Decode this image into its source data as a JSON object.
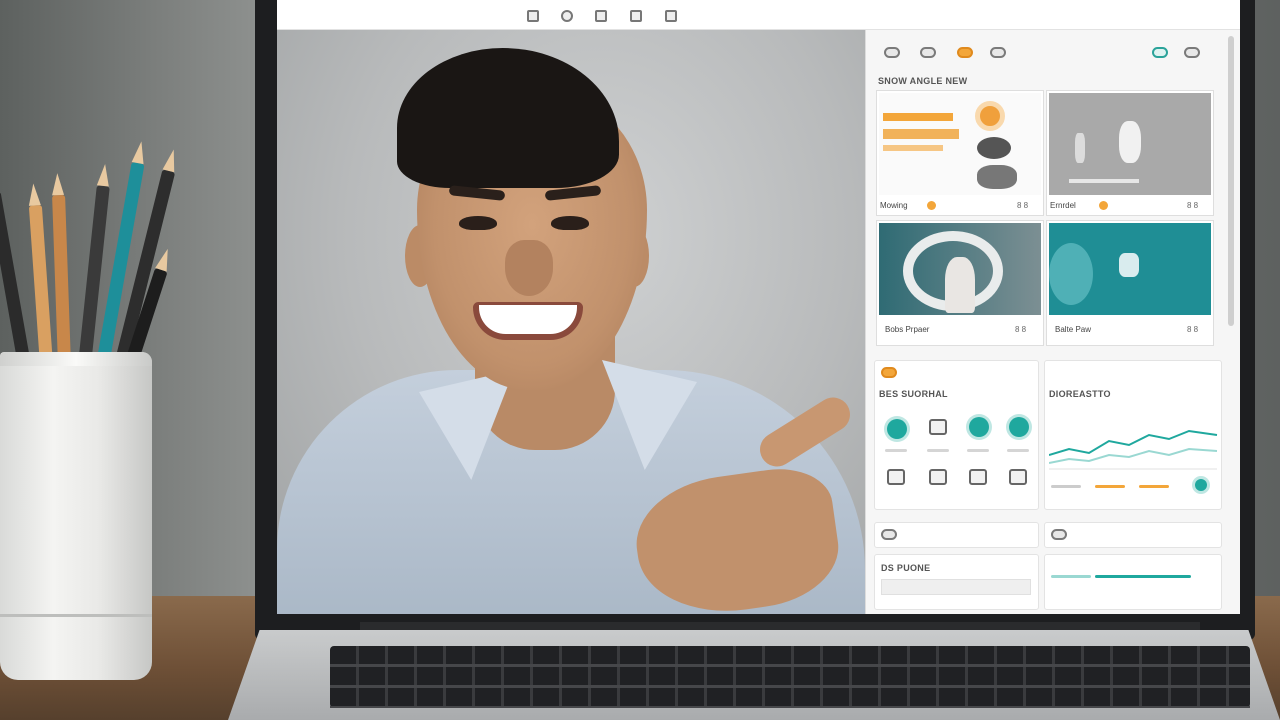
{
  "scene": {
    "description_free": true,
    "pencil_colors": [
      "#2b2b2b",
      "#d9a061",
      "#1e8f9a",
      "#3a3a3a",
      "#c8874a",
      "#2d2d2d",
      "#e0b67a",
      "#1d1d1d"
    ]
  },
  "screen_app": {
    "toolbar_icons": [
      "square-icon",
      "record-icon",
      "square-icon",
      "square-icon",
      "square-icon"
    ],
    "side_panel": {
      "section_heading": "SNOW ANGLE NEW",
      "cards": [
        {
          "caption": "Mowing",
          "meta": "8 8",
          "accent": "#f3a63a"
        },
        {
          "caption": "Ernrdel",
          "meta": "8 8",
          "accent": "#f3a63a"
        },
        {
          "caption": "Bobs Prpaer",
          "meta": "8 8",
          "accent": "#e08a1d"
        },
        {
          "caption": "Balte Paw",
          "meta": "8 8",
          "accent": "#e08a1d"
        }
      ],
      "tools_heading": "BES SUORHAL",
      "chart_heading": "DIOREASTTO",
      "note_heading": "DS PUONE",
      "accent_color": "#f3a63a",
      "teal_color": "#1fa89e"
    }
  }
}
